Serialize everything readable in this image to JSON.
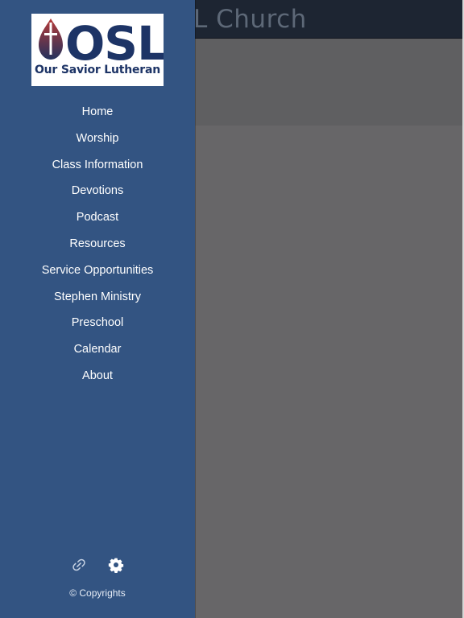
{
  "app": {
    "title": "L Church"
  },
  "logo": {
    "main_text": "OSL",
    "subtitle": "Our Savior Lutheran"
  },
  "nav": {
    "items": [
      {
        "label": "Home"
      },
      {
        "label": "Worship"
      },
      {
        "label": "Class Information"
      },
      {
        "label": "Devotions"
      },
      {
        "label": "Podcast"
      },
      {
        "label": "Resources"
      },
      {
        "label": "Service Opportunities"
      },
      {
        "label": "Stephen Ministry"
      },
      {
        "label": "Preschool"
      },
      {
        "label": "Calendar"
      },
      {
        "label": "About"
      }
    ]
  },
  "footer": {
    "copyright": "© Copyrights",
    "icons": {
      "link": "link-icon",
      "settings": "gear-icon"
    }
  },
  "colors": {
    "drawer": "#335482",
    "topbar": "#1d2532",
    "logo_navy": "#1d3466",
    "logo_red": "#b33a37"
  }
}
